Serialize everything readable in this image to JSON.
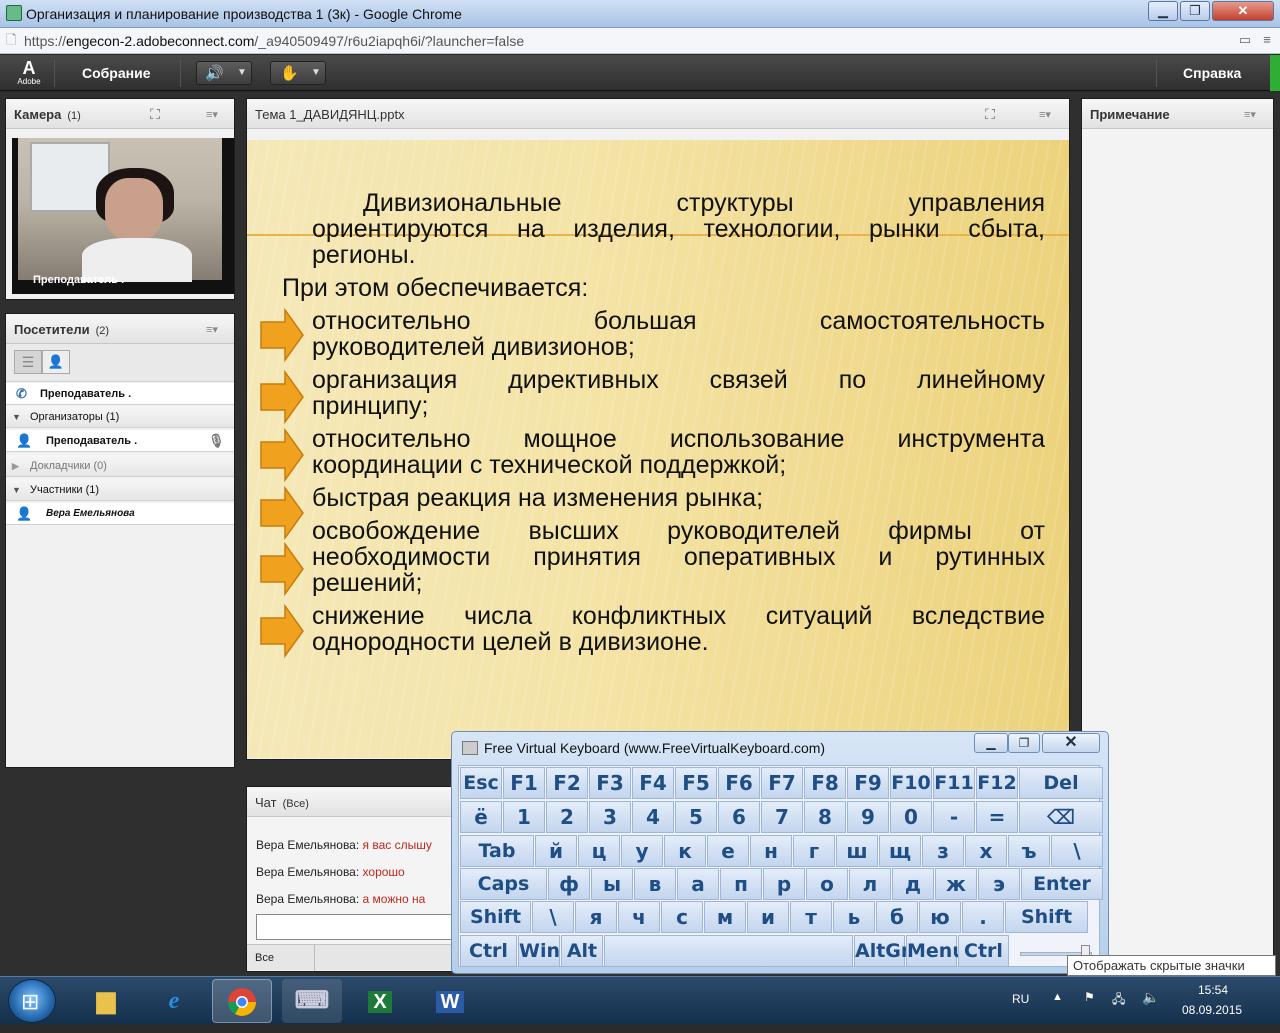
{
  "browser": {
    "window_title": "Организация и планирование производства 1 (3к) - Google Chrome",
    "url_prefix": "https://",
    "url_host": "engecon-2.adobeconnect.com",
    "url_path": "/_a940509497/r6u2iapqh6i/?launcher=false",
    "min_label": "▁",
    "max_label": "❐",
    "close_label": "✕"
  },
  "adobe": {
    "logo_text": "Adobe",
    "meeting_menu": "Собрание",
    "help_menu": "Справка"
  },
  "camera": {
    "title": "Камера",
    "count": "(1)",
    "video_label": "Преподаватель ."
  },
  "attendees": {
    "title": "Посетители",
    "count": "(2)",
    "presenter": "Преподаватель .",
    "hosts_group": "Организаторы (1)",
    "host_name": "Преподаватель .",
    "presenters_group": "Докладчики (0)",
    "participants_group": "Участники (1)",
    "participant_name": "Вера Емельянова"
  },
  "share": {
    "title": "Тема 1_ДАВИДЯНЦ.pptx",
    "slide": {
      "line1": "Дивизиональные структуры управления",
      "line2": "ориентируются на изделия, технологии, рынки сбыта,",
      "line3": "регионы.",
      "line4": "При этом обеспечивается:",
      "b1a": "относительно большая самостоятельность",
      "b1b": "руководителей дивизионов;",
      "b2a": "организация директивных связей по линейному",
      "b2b": "принципу;",
      "b3a": "относительно мощное использование инструмента",
      "b3b": "координации с технической поддержкой;",
      "b4a": "быстрая реакция на изменения рынка;",
      "b5a": "освобождение высших руководителей фирмы от",
      "b5b": "необходимости принятия оперативных и рутинных",
      "b5c": "решений;",
      "b6a": "снижение числа конфликтных ситуаций вследствие",
      "b6b": "однородности целей в дивизионе."
    }
  },
  "notes": {
    "title": "Примечание"
  },
  "chat": {
    "title": "Чат",
    "scope": "(Все)",
    "messages": [
      {
        "author": "Вера Емельянова:",
        "text": "я вас слышу"
      },
      {
        "author": "Вера Емельянова:",
        "text": "хорошо"
      },
      {
        "author": "Вера Емельянова:",
        "text": "а можно на"
      }
    ],
    "recipient": "Все"
  },
  "keyboard": {
    "title": "Free Virtual Keyboard (www.FreeVirtualKeyboard.com)",
    "rows": [
      [
        "Esc",
        "F1",
        "F2",
        "F3",
        "F4",
        "F5",
        "F6",
        "F7",
        "F8",
        "F9",
        "F10",
        "F11",
        "F12",
        "Del"
      ],
      [
        "ё",
        "1",
        "2",
        "3",
        "4",
        "5",
        "6",
        "7",
        "8",
        "9",
        "0",
        "-",
        "=",
        "⌫"
      ],
      [
        "Tab",
        "й",
        "ц",
        "у",
        "к",
        "е",
        "н",
        "г",
        "ш",
        "щ",
        "з",
        "х",
        "ъ",
        "\\"
      ],
      [
        "Caps",
        "ф",
        "ы",
        "в",
        "а",
        "п",
        "р",
        "о",
        "л",
        "д",
        "ж",
        "э",
        "Enter"
      ],
      [
        "Shift",
        "\\",
        "я",
        "ч",
        "с",
        "м",
        "и",
        "т",
        "ь",
        "б",
        "ю",
        ".",
        "Shift"
      ],
      [
        "Ctrl",
        "Win",
        "Alt",
        "",
        "AltGr",
        "Menu",
        "Ctrl"
      ]
    ]
  },
  "tooltip": "Отображать скрытые значки",
  "taskbar": {
    "lang": "RU",
    "time": "15:54",
    "date": "08.09.2015"
  }
}
